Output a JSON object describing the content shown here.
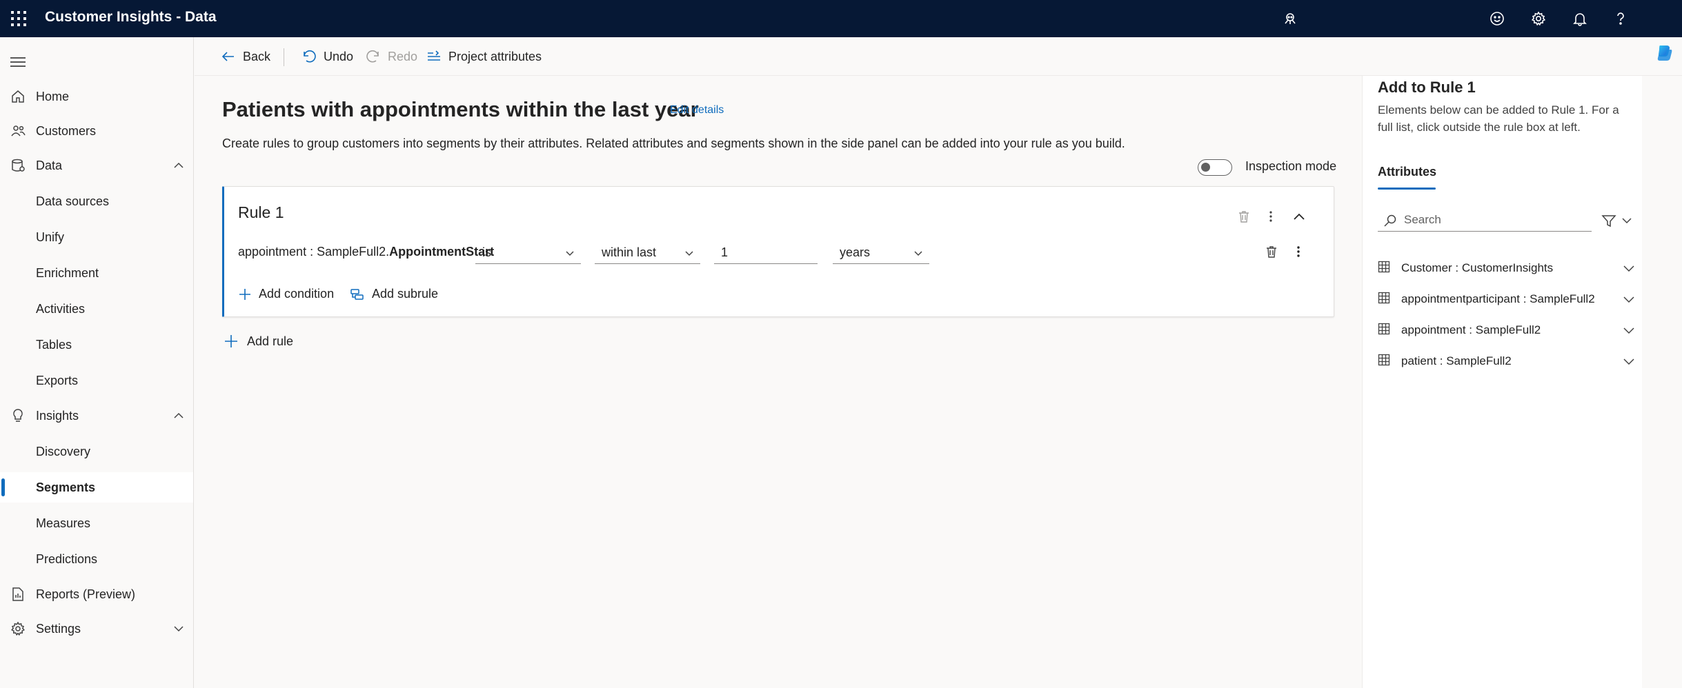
{
  "app": {
    "title": "Customer Insights - Data"
  },
  "topbar": {
    "icons": [
      "waffle-icon",
      "assistant-icon",
      "feedback-smiley-icon",
      "gear-icon",
      "bell-icon",
      "help-icon"
    ]
  },
  "nav": {
    "items": [
      {
        "label": "Home",
        "icon": "home-icon"
      },
      {
        "label": "Customers",
        "icon": "people-icon"
      },
      {
        "label": "Data",
        "icon": "database-icon"
      },
      {
        "label": "Data sources"
      },
      {
        "label": "Unify"
      },
      {
        "label": "Enrichment"
      },
      {
        "label": "Activities"
      },
      {
        "label": "Tables"
      },
      {
        "label": "Exports"
      },
      {
        "label": "Insights",
        "icon": "lightbulb-icon"
      },
      {
        "label": "Discovery"
      },
      {
        "label": "Segments",
        "selected": true
      },
      {
        "label": "Measures"
      },
      {
        "label": "Predictions"
      },
      {
        "label": "Reports (Preview)",
        "icon": "report-icon"
      },
      {
        "label": "Settings",
        "icon": "gear-icon"
      }
    ]
  },
  "commandbar": {
    "back": "Back",
    "undo": "Undo",
    "redo": "Redo",
    "project_attributes": "Project attributes"
  },
  "main": {
    "title": "Patients with appointments within the last year",
    "edit_link": "Edit details",
    "description": "Create rules to group customers into segments by their attributes. Related attributes and segments shown in the side panel can be added into your rule as you build.",
    "inspection_mode": "Inspection mode",
    "rule": {
      "title": "Rule 1",
      "condition": {
        "attr_prefix": "appointment : SampleFull2.",
        "attr_name": "AppointmentStart",
        "operator": "is",
        "range": "within last",
        "value": "1",
        "unit": "years"
      },
      "add_condition": "Add condition",
      "add_subrule": "Add subrule"
    },
    "add_rule": "Add rule"
  },
  "panel": {
    "title": "Add to Rule 1",
    "description": "Elements below can be added to Rule 1. For a full list, click outside the rule box at left.",
    "tab": "Attributes",
    "search_placeholder": "Search",
    "items": [
      {
        "label": "Customer : CustomerInsights"
      },
      {
        "label": "appointmentparticipant : SampleFull2"
      },
      {
        "label": "appointment : SampleFull2"
      },
      {
        "label": "patient : SampleFull2"
      }
    ]
  },
  "colors": {
    "topbar": "#061835",
    "accent": "#0f6cbd"
  }
}
